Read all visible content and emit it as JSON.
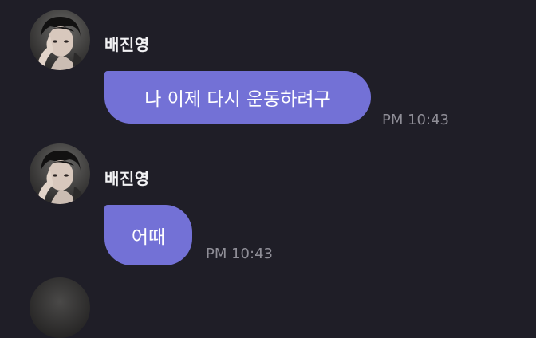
{
  "messages": [
    {
      "sender": "배진영",
      "text": "나 이제 다시 운동하려구",
      "time": "PM 10:43"
    },
    {
      "sender": "배진영",
      "text": "어때",
      "time": "PM 10:43"
    }
  ],
  "colors": {
    "background": "#1f1e27",
    "bubble": "#7371d6",
    "sender_text": "#f2f2f4",
    "timestamp": "#8f8e97"
  },
  "icons": {
    "avatar": "profile-photo"
  }
}
